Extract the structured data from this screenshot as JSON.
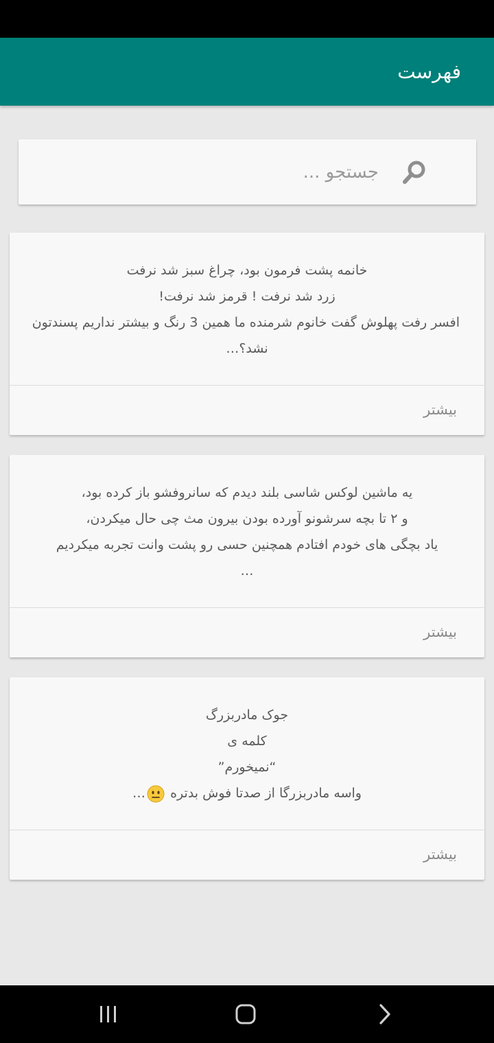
{
  "app_bar": {
    "title": "فهرست",
    "color": "#00807a"
  },
  "search": {
    "placeholder": "جستجو ...",
    "value": "",
    "icon": "search-icon"
  },
  "jokes": [
    {
      "lines": [
        "خانمه پشت فرمون بود، چراغ سبز شد نرفت",
        "زرد شد نرفت ! قرمز شد نرفت!",
        "افسر رفت پهلوش گفت خانوم شرمنده ما همین 3 رنگ و بیشتر نداریم پسندتون",
        "نشد؟…"
      ],
      "more_label": "بیشتر"
    },
    {
      "lines": [
        "یه ماشین لوکس شاسی بلند دیدم که سانروفشو باز کرده بود،",
        "و ۲ تا بچه سرشونو آورده بودن بیرون مث چی حال میکردن،",
        "یاد بچگی های خودم افتادم همچنین حسی رو پشت وانت تجربه میکردیم",
        "…"
      ],
      "more_label": "بیشتر"
    },
    {
      "lines": [
        "جوک مادربزرگ",
        "کلمه ی",
        "“نمیخورم”",
        "واسه مادربزرگا از صدتا فوش بدتره",
        "…"
      ],
      "emoji": "neutral-face-emoji",
      "more_label": "بیشتر"
    }
  ],
  "nav": {
    "recents_icon": "recents-icon",
    "home_icon": "home-icon",
    "back_icon": "back-icon"
  }
}
